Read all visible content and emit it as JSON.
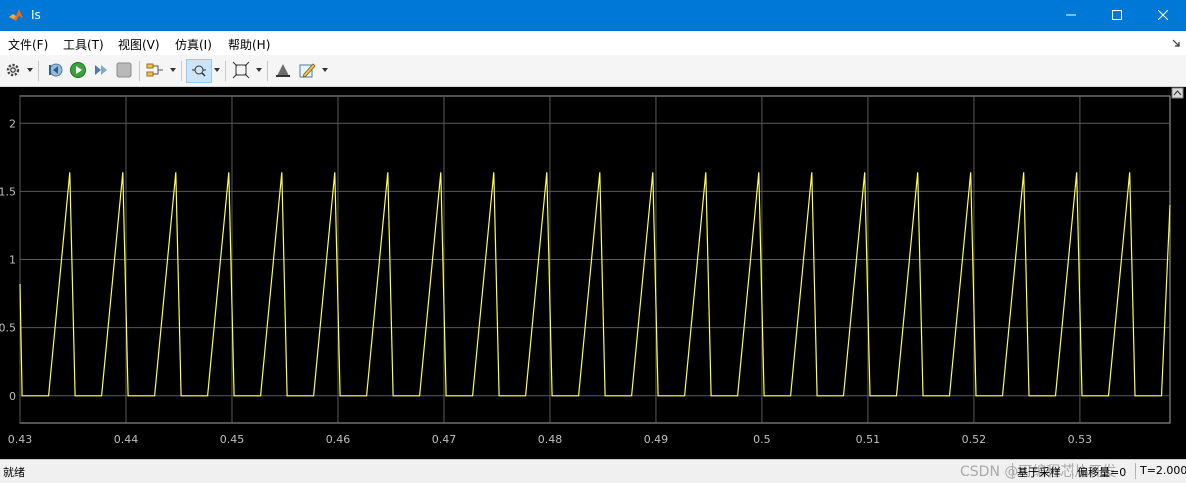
{
  "window": {
    "title": "Is",
    "controls": {
      "minimize": "minimize-icon",
      "maximize": "maximize-icon",
      "close": "close-icon"
    }
  },
  "menu": {
    "items": [
      {
        "label": "文件(F)"
      },
      {
        "label": "工具(T)"
      },
      {
        "label": "视图(V)"
      },
      {
        "label": "仿真(I)"
      },
      {
        "label": "帮助(H)"
      }
    ]
  },
  "toolbar": {
    "icons": [
      "gear-icon",
      "step-back-icon",
      "run-icon",
      "step-forward-icon",
      "stop-icon",
      "signal-select-icon",
      "zoom-x-icon",
      "fit-view-icon",
      "style-icon",
      "edit-icon"
    ]
  },
  "statusbar": {
    "left": "就绪",
    "mode": "基于采样",
    "offset": "偏移量=0",
    "time": "T=2.000"
  },
  "watermark": "CSDN @可编程芯片开发",
  "colors": {
    "titlebar": "#0078d7",
    "plot_background": "#000000",
    "trace": "#ffff4d",
    "grid": "#5a5a5a",
    "axes_text": "#bfbfbf"
  },
  "chart_data": {
    "type": "line",
    "title": "",
    "xlabel": "",
    "ylabel": "",
    "xlim": [
      0.43,
      0.5385
    ],
    "ylim": [
      -0.2,
      2.2
    ],
    "xticks": [
      0.43,
      0.44,
      0.45,
      0.46,
      0.47,
      0.48,
      0.49,
      0.5,
      0.51,
      0.52,
      0.53
    ],
    "yticks": [
      0,
      0.5,
      1,
      1.5,
      2
    ],
    "xtick_labels": [
      "0.43",
      "0.44",
      "0.45",
      "0.46",
      "0.47",
      "0.48",
      "0.49",
      "0.5",
      "0.51",
      "0.52",
      "0.53"
    ],
    "ytick_labels": [
      "0",
      "0.5",
      "1",
      "1.5",
      "2"
    ],
    "grid": true,
    "waveform": {
      "period": 0.005,
      "first_zero_start": 0.4302,
      "zero_duration": 0.0025,
      "ramp_duration": 0.002,
      "fall_duration": 0.0005,
      "peak": 1.64
    },
    "series": [
      {
        "x": [
          0.43,
          0.4302,
          0.4327,
          0.4347,
          0.4352,
          0.4377,
          0.4397,
          0.4402,
          0.4427,
          0.4447,
          0.4452,
          0.4477,
          0.4497,
          0.4502,
          0.4527,
          0.4547,
          0.4552,
          0.4577,
          0.4597,
          0.4602,
          0.4627,
          0.4647,
          0.4652,
          0.4677,
          0.4697,
          0.4702,
          0.4727,
          0.4747,
          0.4752,
          0.4777,
          0.4797,
          0.4802,
          0.4827,
          0.4847,
          0.4852,
          0.4877,
          0.4897,
          0.4902,
          0.4927,
          0.4947,
          0.4952,
          0.4977,
          0.4997,
          0.5002,
          0.5027,
          0.5047,
          0.5052,
          0.5077,
          0.5097,
          0.5102,
          0.5127,
          0.5147,
          0.5152,
          0.5177,
          0.5197,
          0.5202,
          0.5227,
          0.5247,
          0.5252,
          0.5277,
          0.5297,
          0.5302,
          0.5327,
          0.5347,
          0.5352,
          0.5377,
          0.5385
        ],
        "y": [
          0.82,
          0,
          0,
          1.64,
          0,
          0,
          1.64,
          0,
          0,
          1.64,
          0,
          0,
          1.64,
          0,
          0,
          1.64,
          0,
          0,
          1.64,
          0,
          0,
          1.64,
          0,
          0,
          1.64,
          0,
          0,
          1.64,
          0,
          0,
          1.64,
          0,
          0,
          1.64,
          0,
          0,
          1.64,
          0,
          0,
          1.64,
          0,
          0,
          1.64,
          0,
          0,
          1.64,
          0,
          0,
          1.64,
          0,
          0,
          1.64,
          0,
          0,
          1.64,
          0,
          0,
          1.64,
          0,
          0,
          1.64,
          0,
          0,
          1.64,
          0,
          0,
          1.4
        ]
      }
    ]
  }
}
